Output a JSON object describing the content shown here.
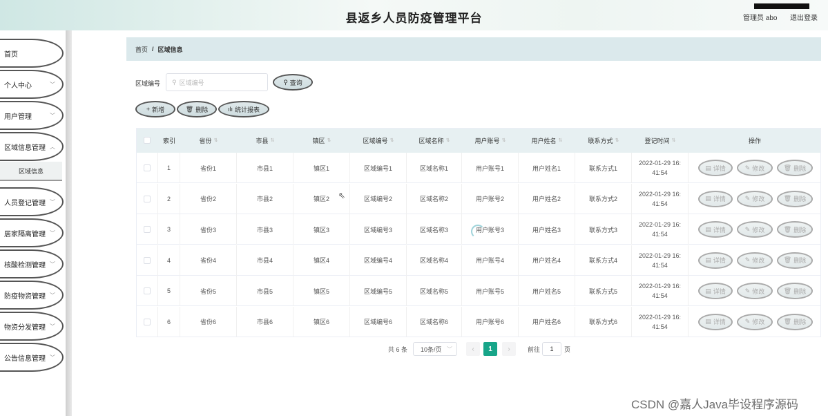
{
  "header": {
    "title": "县返乡人员防疫管理平台",
    "user": "管理员 abo",
    "logout": "退出登录"
  },
  "sidebar": {
    "items": [
      {
        "label": "首页"
      },
      {
        "label": "个人中心"
      },
      {
        "label": "用户管理"
      },
      {
        "label": "区域信息管理"
      },
      {
        "label": "人员登记管理"
      },
      {
        "label": "居家隔离管理"
      },
      {
        "label": "核酸检测管理"
      },
      {
        "label": "防疫物资管理"
      },
      {
        "label": "物资分发管理"
      },
      {
        "label": "公告信息管理"
      }
    ],
    "submenu": "区域信息"
  },
  "breadcrumb": {
    "home": "首页",
    "sep": "/",
    "current": "区域信息"
  },
  "search": {
    "label": "区域编号",
    "placeholder": "区域编号",
    "button": "查询"
  },
  "toolbar": {
    "add": "新增",
    "delete": "删除",
    "report": "统计报表"
  },
  "table": {
    "headers": [
      "索引",
      "省份",
      "市县",
      "镇区",
      "区域编号",
      "区域名称",
      "用户账号",
      "用户姓名",
      "联系方式",
      "登记时间",
      "操作"
    ],
    "rows": [
      [
        "1",
        "省份1",
        "市县1",
        "镇区1",
        "区域编号1",
        "区域名称1",
        "用户账号1",
        "用户姓名1",
        "联系方式1",
        "2022-01-29 16:",
        "41:54"
      ],
      [
        "2",
        "省份2",
        "市县2",
        "镇区2",
        "区域编号2",
        "区域名称2",
        "用户账号2",
        "用户姓名2",
        "联系方式2",
        "2022-01-29 16:",
        "41:54"
      ],
      [
        "3",
        "省份3",
        "市县3",
        "镇区3",
        "区域编号3",
        "区域名称3",
        "用户账号3",
        "用户姓名3",
        "联系方式3",
        "2022-01-29 16:",
        "41:54"
      ],
      [
        "4",
        "省份4",
        "市县4",
        "镇区4",
        "区域编号4",
        "区域名称4",
        "用户账号4",
        "用户姓名4",
        "联系方式4",
        "2022-01-29 16:",
        "41:54"
      ],
      [
        "5",
        "省份5",
        "市县5",
        "镇区5",
        "区域编号5",
        "区域名称5",
        "用户账号5",
        "用户姓名5",
        "联系方式5",
        "2022-01-29 16:",
        "41:54"
      ],
      [
        "6",
        "省份6",
        "市县6",
        "镇区6",
        "区域编号6",
        "区域名称6",
        "用户账号6",
        "用户姓名6",
        "联系方式6",
        "2022-01-29 16:",
        "41:54"
      ]
    ],
    "actions": {
      "detail": "详情",
      "edit": "修改",
      "delete": "删除"
    }
  },
  "pagination": {
    "total": "共 6 条",
    "page_size": "10条/页",
    "current": "1",
    "goto": "前往",
    "goto_value": "1",
    "page_unit": "页"
  },
  "watermark": "CSDN @嘉人Java毕设程序源码",
  "colors": {
    "accent": "#17a589",
    "breadcrumb_bg": "#dbe9ec",
    "table_header_bg": "#e7f0f2"
  }
}
